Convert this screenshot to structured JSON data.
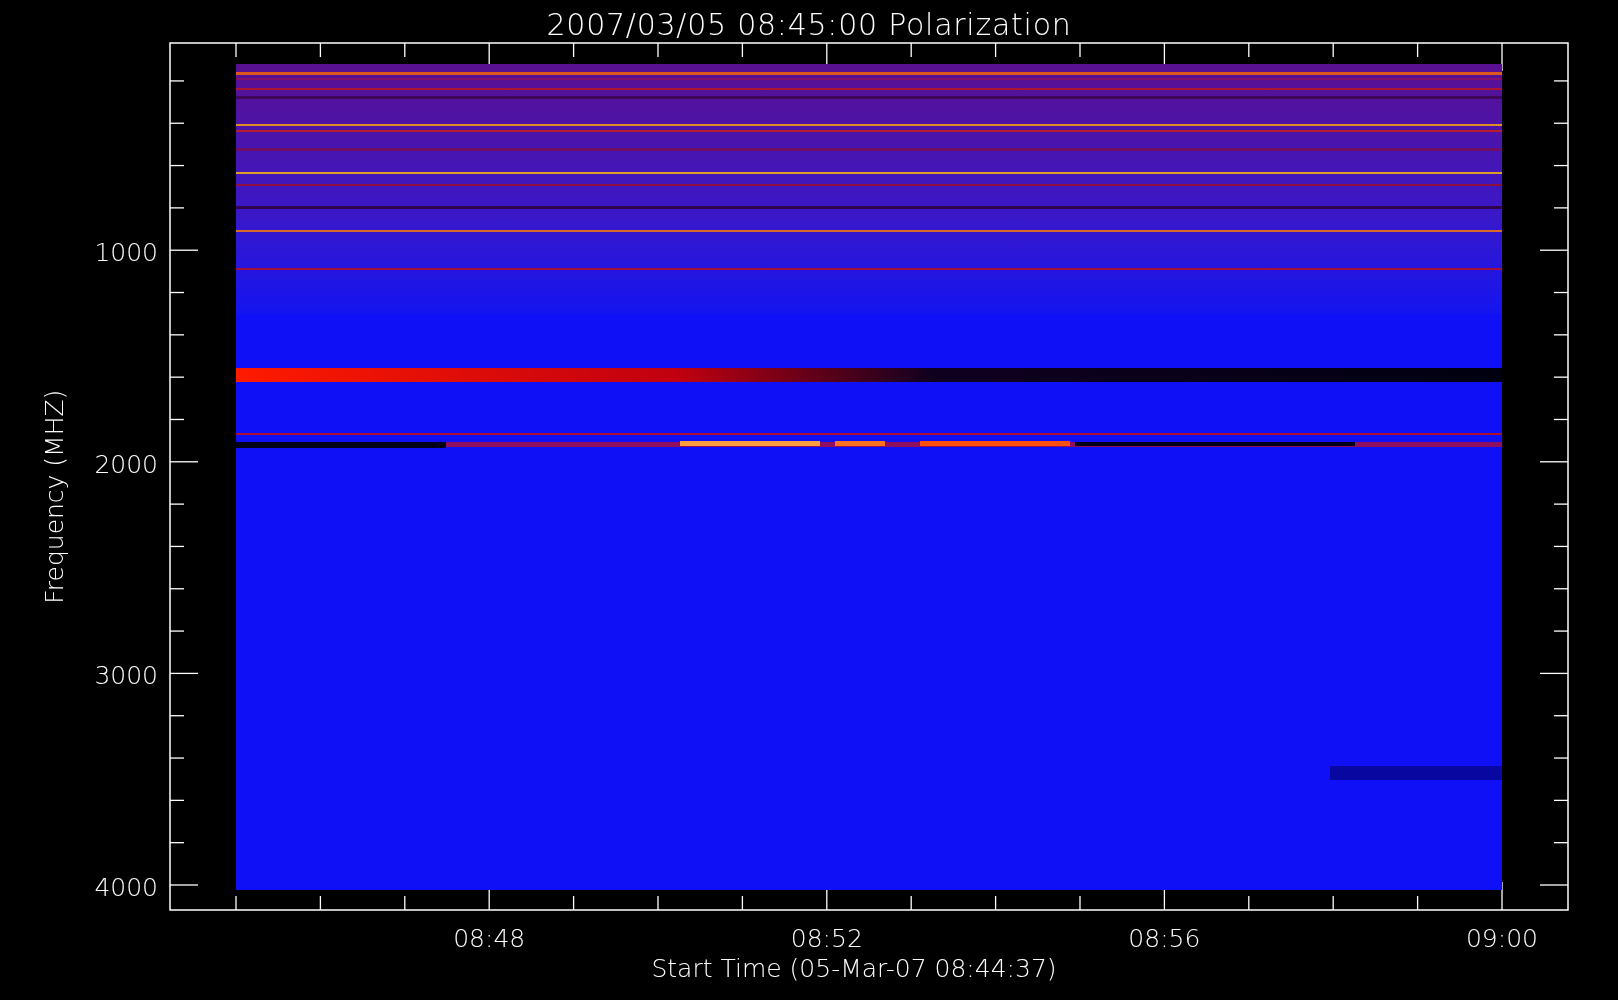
{
  "title": "2007/03/05 08:45:00 Polarization",
  "y_axis": {
    "label": "Frequency (MHZ)",
    "ticks": [
      "1000",
      "2000",
      "3000",
      "4000"
    ]
  },
  "x_axis": {
    "label": "Start Time (05-Mar-07 08:44:37)",
    "ticks": [
      "08:48",
      "08:52",
      "08:56",
      "09:00"
    ]
  }
}
